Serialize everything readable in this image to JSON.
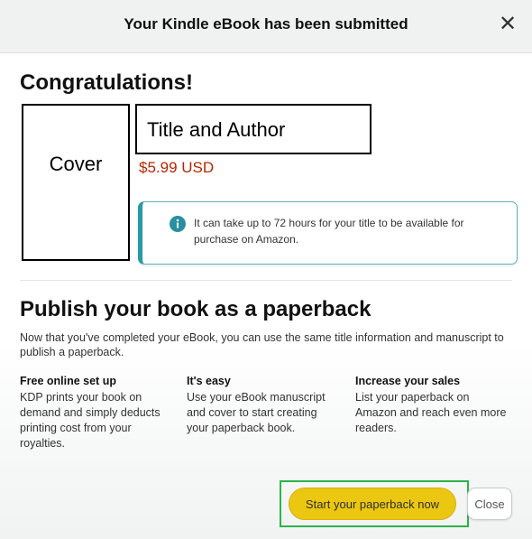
{
  "dialog": {
    "title": "Your Kindle eBook has been submitted",
    "close_icon": "close-icon"
  },
  "congrats": {
    "heading": "Congratulations!",
    "cover_label": "Cover",
    "title_label": "Title and Author",
    "price": "$5.99 USD",
    "info_icon": "info-icon",
    "info_text": "It can take up to 72 hours for your title to be available for purchase on Amazon."
  },
  "paperback": {
    "heading": "Publish your book as a paperback",
    "description": "Now that you've completed your eBook, you can use the same title information and manuscript to publish a paperback.",
    "features": [
      {
        "title": "Free online set up",
        "text": "KDP prints your book on demand and simply deducts printing cost from your royalties."
      },
      {
        "title": "It's easy",
        "text": "Use your eBook manuscript and cover to start creating your paperback book."
      },
      {
        "title": "Increase your sales",
        "text": "List your paperback on Amazon and reach even more readers."
      }
    ]
  },
  "actions": {
    "start_label": "Start your paperback now",
    "close_label": "Close",
    "accent_color": "#ffd814",
    "highlight_color": "#2db34a"
  }
}
